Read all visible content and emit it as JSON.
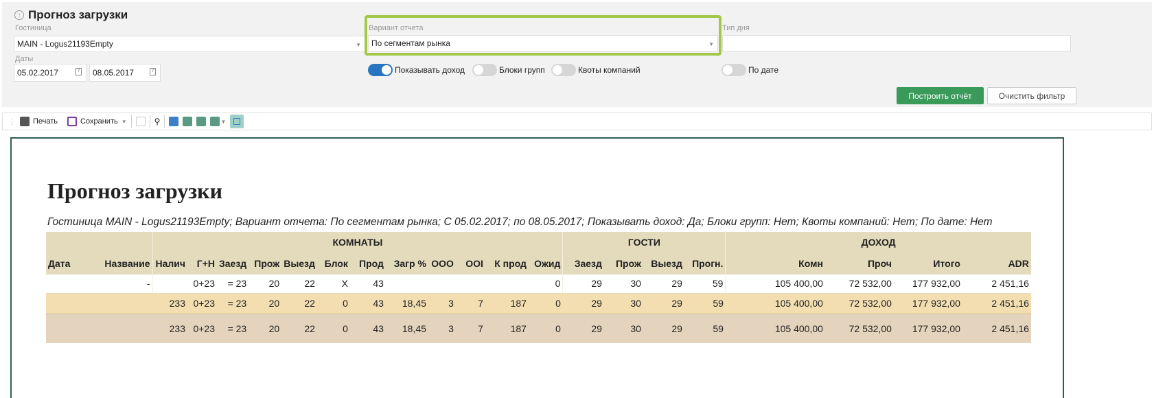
{
  "header": {
    "title": "Прогноз загрузки"
  },
  "filters": {
    "hotel_label": "Гостиница",
    "hotel_value": "MAIN - Logus21193Empty",
    "dates_label": "Даты",
    "date_from": "05.02.2017",
    "date_to": "08.05.2017",
    "variant_label": "Вариант отчета",
    "variant_value": "По сегментам рынка",
    "daytype_label": "Тип дня",
    "daytype_value": "",
    "toggles": [
      {
        "label": "Показывать доход",
        "on": true
      },
      {
        "label": "Блоки групп",
        "on": false
      },
      {
        "label": "Квоты компаний",
        "on": false
      },
      {
        "label": "По дате",
        "on": false
      }
    ],
    "build_label": "Построить отчёт",
    "clear_label": "Очистить фильтр",
    "accent": "#3a9a5a",
    "highlight": "#a4c84a"
  },
  "toolbar": {
    "print": "Печать",
    "save": "Сохранить"
  },
  "report": {
    "title": "Прогноз загрузки",
    "subtitle": "Гостиница MAIN - Logus21193Empty; Вариант отчета: По сегментам рынка; С 05.02.2017; по 08.05.2017; Показывать доход: Да; Блоки групп: Нет; Квоты компаний: Нет; По дате: Нет",
    "groups": [
      "КОМНАТЫ",
      "ГОСТИ",
      "ДОХОД"
    ],
    "columns": [
      "Дата",
      "Название",
      "Налич",
      "Г+Н",
      "Заезд",
      "Прож",
      "Выезд",
      "Блок",
      "Прод",
      "Загр %",
      "ООО",
      "OOI",
      "К прод",
      "Ожид",
      "Заезд",
      "Прож",
      "Выезд",
      "Прогн.",
      "Комн",
      "Проч",
      "Итого",
      "ADR"
    ],
    "rows": [
      [
        "",
        "-",
        "",
        "0+23",
        "= 23",
        "20",
        "22",
        "X",
        "43",
        "",
        "",
        "",
        "",
        "0",
        "29",
        "30",
        "29",
        "59",
        "105 400,00",
        "72 532,00",
        "177 932,00",
        "2 451,16"
      ],
      [
        "",
        "",
        "233",
        "0+23",
        "= 23",
        "20",
        "22",
        "0",
        "43",
        "18,45",
        "3",
        "7",
        "187",
        "0",
        "29",
        "30",
        "29",
        "59",
        "105 400,00",
        "72 532,00",
        "177 932,00",
        "2 451,16"
      ],
      [
        "",
        "",
        "233",
        "0+23",
        "= 23",
        "20",
        "22",
        "0",
        "43",
        "18,45",
        "3",
        "7",
        "187",
        "0",
        "29",
        "30",
        "29",
        "59",
        "105 400,00",
        "72 532,00",
        "177 932,00",
        "2 451,16"
      ]
    ]
  }
}
